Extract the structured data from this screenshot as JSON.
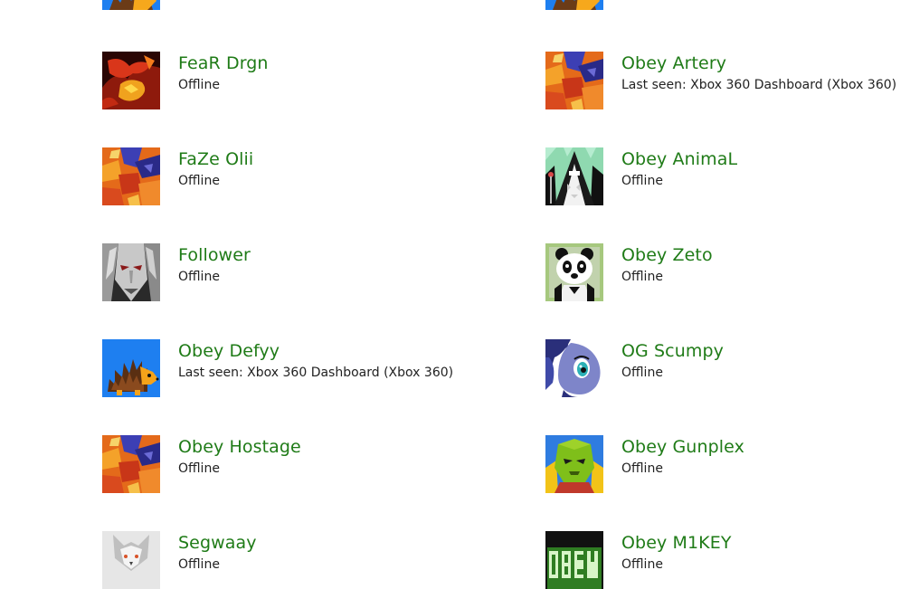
{
  "friends": [
    {
      "name": "",
      "status": "",
      "avatar": "hedgehog-avatar-icon",
      "bg": "#1e7ff0"
    },
    {
      "name": "",
      "status": "",
      "avatar": "hedgehog-avatar-icon",
      "bg": "#1e7ff0"
    },
    {
      "name": "FeaR Drgn",
      "status": "Offline",
      "avatar": "red-dragon-avatar-icon"
    },
    {
      "name": "Obey Artery",
      "status": "Last seen: Xbox 360 Dashboard (Xbox 360)",
      "avatar": "abstract-art-avatar-icon"
    },
    {
      "name": "FaZe Olii",
      "status": "Offline",
      "avatar": "abstract-art-avatar-icon"
    },
    {
      "name": "Obey AnimaL",
      "status": "Offline",
      "avatar": "wizard-avatar-icon"
    },
    {
      "name": "Follower",
      "status": "Offline",
      "avatar": "dark-character-avatar-icon"
    },
    {
      "name": "Obey Zeto",
      "status": "Offline",
      "avatar": "panda-avatar-icon"
    },
    {
      "name": "Obey Defyy",
      "status": "Last seen: Xbox 360 Dashboard (Xbox 360)",
      "avatar": "hedgehog-avatar-icon"
    },
    {
      "name": "OG Scumpy",
      "status": "Offline",
      "avatar": "pony-avatar-icon"
    },
    {
      "name": "Obey Hostage",
      "status": "Offline",
      "avatar": "abstract-art-avatar-icon"
    },
    {
      "name": "Obey Gunplex",
      "status": "Offline",
      "avatar": "green-creature-avatar-icon"
    },
    {
      "name": "Segwaay",
      "status": "Offline",
      "avatar": "wolf-avatar-icon"
    },
    {
      "name": "Obey M1KEY",
      "status": "Offline",
      "avatar": "obey-logo-avatar-icon"
    }
  ],
  "colors": {
    "name_text": "#1f7b17",
    "status_text": "#222222",
    "hedgehog_bg": "#1e7ff0"
  }
}
